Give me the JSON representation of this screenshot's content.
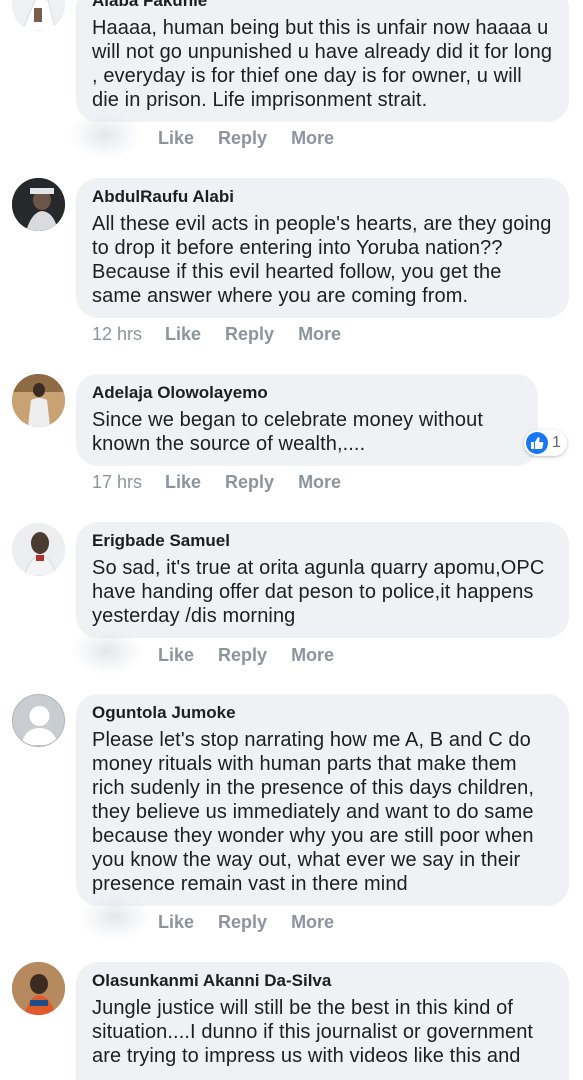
{
  "comments": [
    {
      "author": "Alaba Fakunle",
      "text": "Haaaa, human being but this is unfair now haaaa u will not go unpunished u have already did it for long , everyday is for thief one day is for owner, u will die in prison. Life imprisonment strait.",
      "time": "",
      "like_label": "Like",
      "reply_label": "Reply",
      "more_label": "More"
    },
    {
      "author": "AbdulRaufu Alabi",
      "text": "All these evil acts in people's hearts, are they going to drop it before entering into Yoruba nation?? Because if this evil hearted follow, you get the same answer where you are coming from.",
      "time": "12 hrs",
      "like_label": "Like",
      "reply_label": "Reply",
      "more_label": "More"
    },
    {
      "author": "Adelaja Olowolayemo",
      "text": "Since we began to celebrate money without known the source of wealth,....",
      "time": "17 hrs",
      "like_label": "Like",
      "reply_label": "Reply",
      "more_label": "More",
      "reaction_count": "1",
      "reaction_icon": "thumbs-up-icon"
    },
    {
      "author": "Erigbade Samuel",
      "text": "So sad, it's true at orita agunla quarry apomu,OPC have handing offer dat peson to police,it happens yesterday /dis morning",
      "time": "",
      "like_label": "Like",
      "reply_label": "Reply",
      "more_label": "More"
    },
    {
      "author": "Oguntola Jumoke",
      "text": "Please let's stop narrating how me A, B and C do money rituals with human parts that make them rich sudenly in the presence of this days children, they believe us immediately and want to do same because they wonder why you are still poor when you know the way out, what ever we say in their presence remain vast in there mind",
      "time": "",
      "like_label": "Like",
      "reply_label": "Reply",
      "more_label": "More"
    },
    {
      "author": "Olasunkanmi Akanni Da-Silva",
      "text": "Jungle justice will still be the best in this kind of situation....I dunno if this journalist or government are trying to impress us with videos like this and"
    }
  ],
  "colors": {
    "bubble": "#eff1f4",
    "text": "#1c1e21",
    "meta": "#8d949e",
    "like_blue": "#1877f2"
  }
}
